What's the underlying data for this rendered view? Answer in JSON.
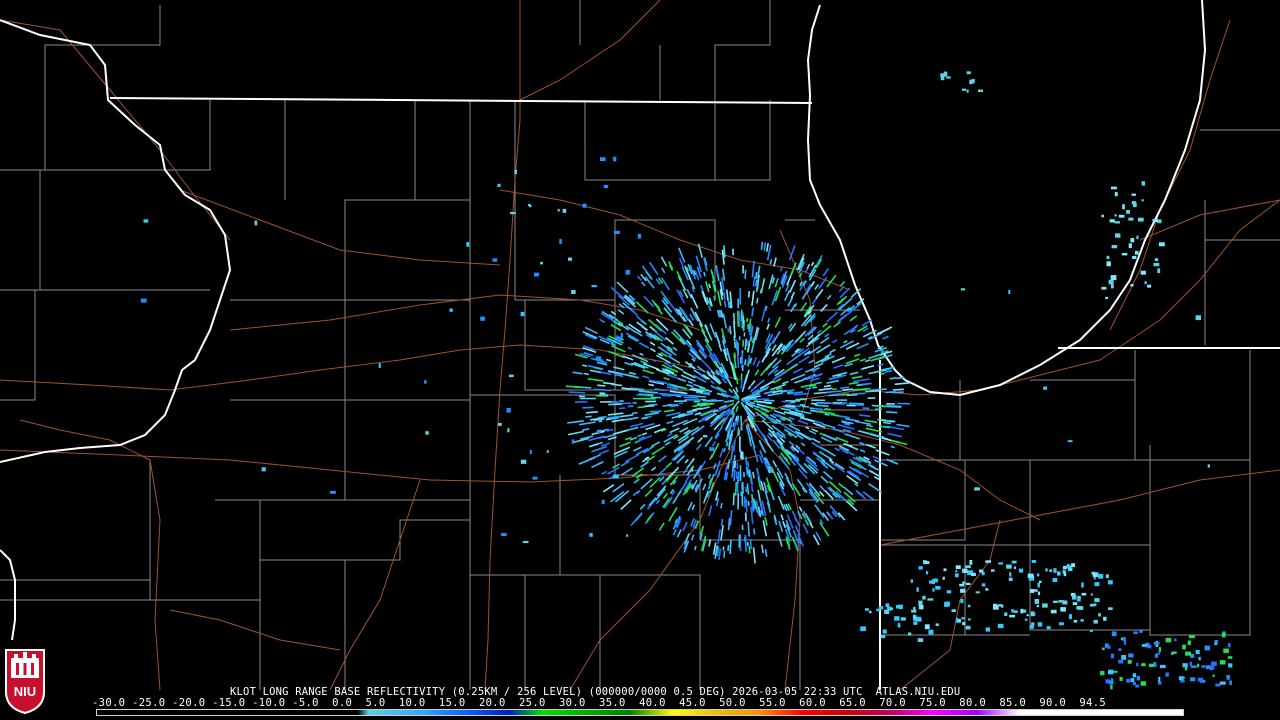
{
  "product": {
    "caption": "KLOT LONG RANGE BASE REFLECTIVITY (0.25KM / 256 LEVEL) (000000/0000 0.5 DEG) 2026-03-05 22:33 UTC  ATLAS.NIU.EDU",
    "scale_labels": "-30.0 -25.0 -20.0 -15.0 -10.0 -5.0  0.0  5.0  10.0  15.0  20.0  25.0  30.0  35.0  40.0  45.0  50.0  55.0  60.0  65.0  70.0  75.0  80.0  85.0  90.0  94.5",
    "logo_text": "NIU"
  },
  "colors": {
    "background": "#000000",
    "state_border": "#ffffff",
    "county_border": "#8a8a8a",
    "highway": "#a0522d",
    "logo_red": "#c8102e"
  }
}
